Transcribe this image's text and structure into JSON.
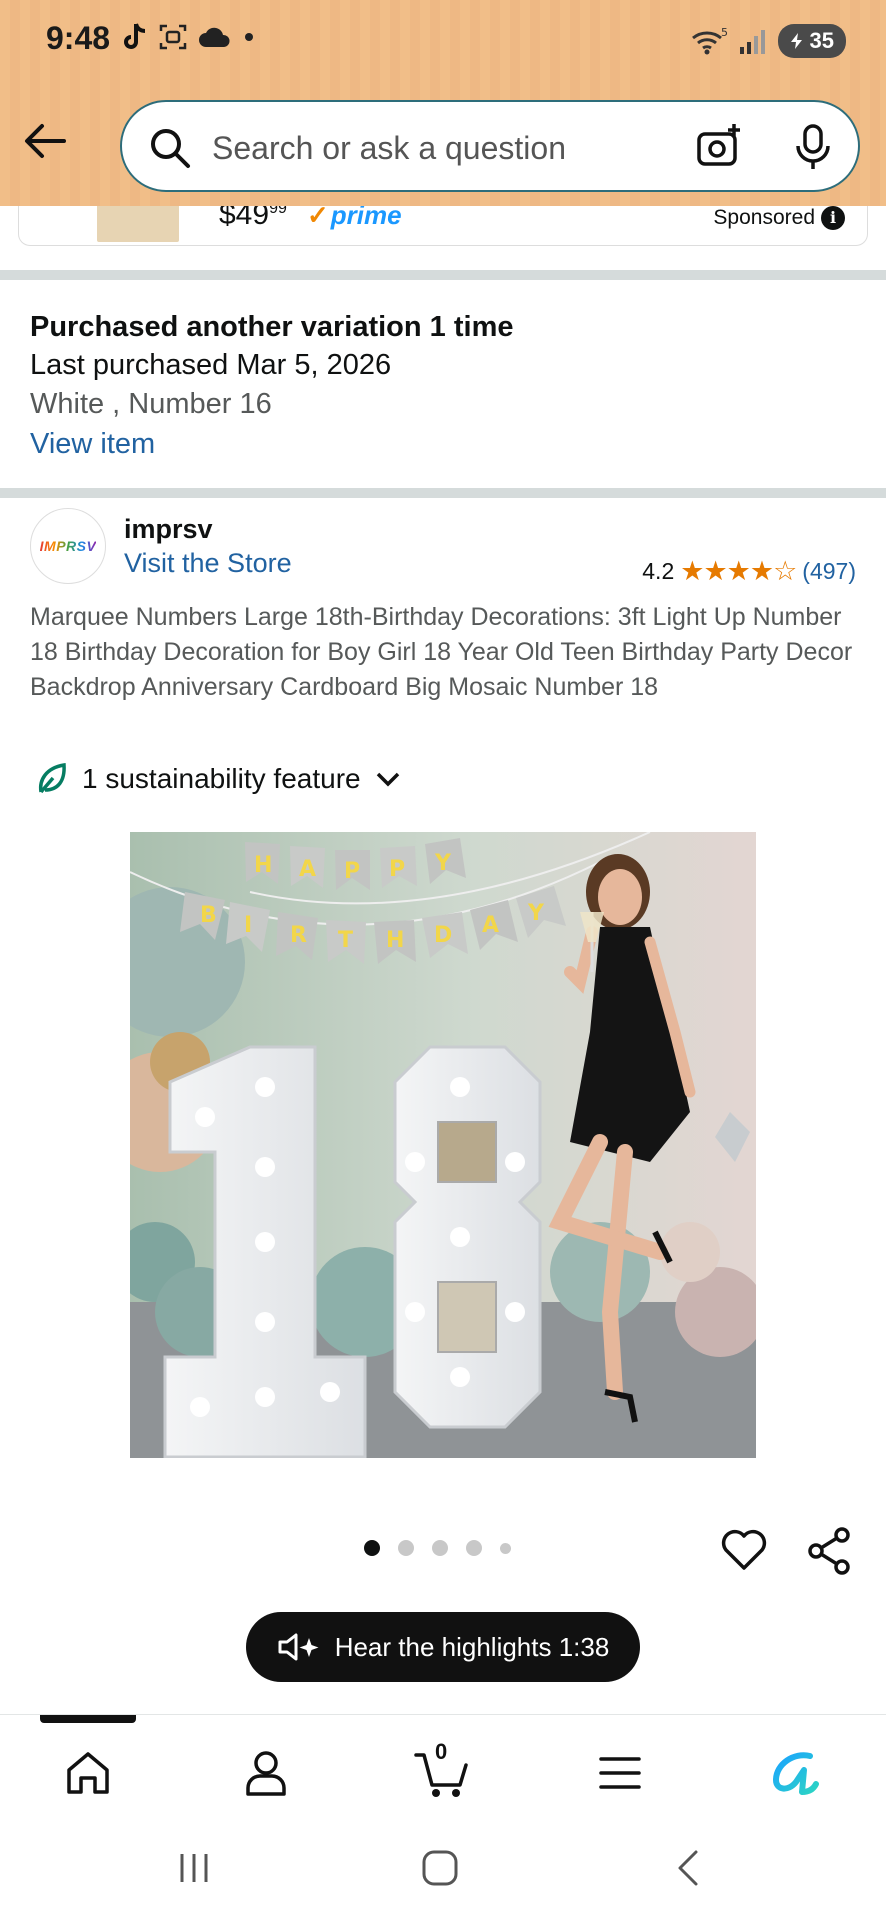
{
  "status_bar": {
    "time": "9:48",
    "battery": "35",
    "wifi_badge": "5",
    "icons": [
      "tiktok-icon",
      "screenshot-icon",
      "cloud-icon",
      "dot-icon",
      "wifi-icon",
      "signal-icon",
      "battery-icon"
    ]
  },
  "header": {
    "search_placeholder": "Search or ask a question",
    "colors": {
      "header_bg": "#f1be88",
      "search_border": "#2d6d7b"
    }
  },
  "sponsored": {
    "price_main": "$49",
    "price_cents": "99",
    "prime_label": "prime",
    "sponsored_label": "Sponsored"
  },
  "purchase_history": {
    "title": "Purchased another variation 1 time",
    "last_purchased": "Last purchased Mar 5, 2026",
    "variation": "White , Number 16",
    "view_item": "View item"
  },
  "store": {
    "logo_text": "IMPRSV",
    "name": "imprsv",
    "visit_link": "Visit the Store",
    "rating": "4.2",
    "review_count": "(497)",
    "stars_value": 4.2
  },
  "product": {
    "title": "Marquee Numbers Large 18th-Birthday Decorations: 3ft Light Up Number 18 Birthday Decoration for Boy Girl 18 Year Old Teen Birthday Party Decor Backdrop Anniversary Cardboard Big Mosaic Number 18",
    "sustainability": "1 sustainability feature",
    "banner_letters_top": [
      "H",
      "A",
      "P",
      "P",
      "Y"
    ],
    "banner_letters_bottom": [
      "B",
      "I",
      "R",
      "T",
      "H",
      "D",
      "A",
      "Y"
    ],
    "image_count": 5,
    "active_image": 1,
    "highlights_label": "Hear the highlights 1:38"
  },
  "bottom_nav": {
    "items": [
      "home-icon",
      "account-icon",
      "cart-icon",
      "menu-icon",
      "rufus-icon"
    ],
    "cart_count": "0",
    "active": "home-icon"
  },
  "system_nav": [
    "recents-button",
    "home-button",
    "back-button"
  ]
}
